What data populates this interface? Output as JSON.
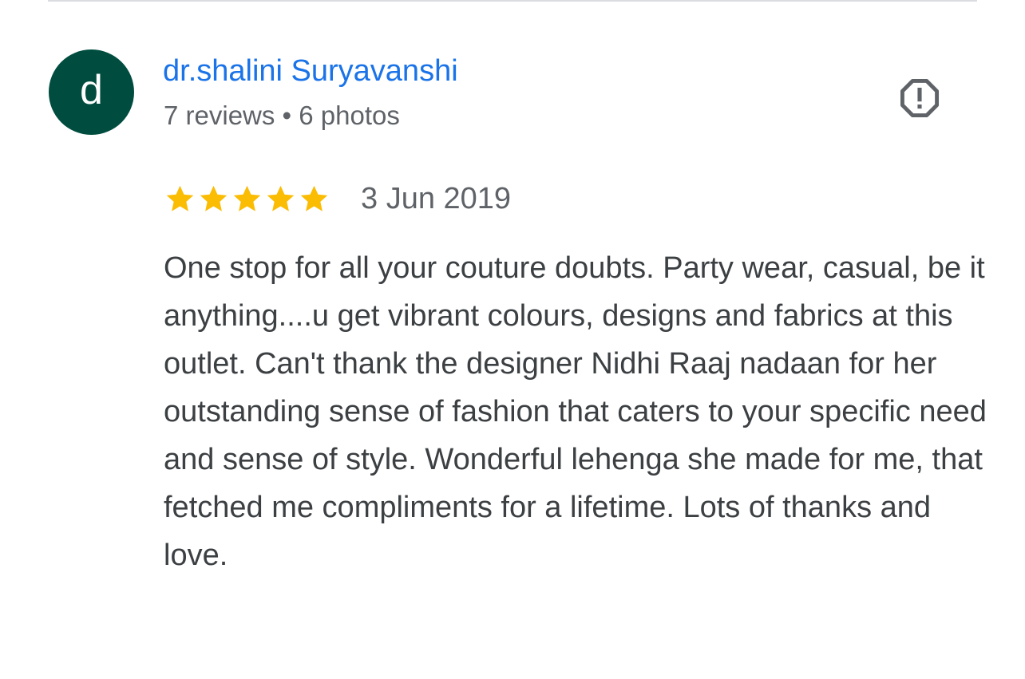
{
  "reviewer": {
    "avatar_letter": "d",
    "avatar_color": "#004d40",
    "name": "dr.shalini Suryavanshi",
    "meta": "7 reviews • 6 photos"
  },
  "report": {
    "icon": "report-flag-icon"
  },
  "review": {
    "rating": 5,
    "rating_max": 5,
    "star_color": "#fbbc04",
    "date": "3 Jun 2019",
    "text": "One stop for all your couture doubts. Party wear, casual, be it anything....u get vibrant colours, designs and fabrics at this outlet. Can't thank the designer Nidhi Raaj nadaan for her outstanding sense of fashion that caters to your specific need and sense of style. Wonderful lehenga she made for me, that fetched me compliments for a lifetime. Lots of thanks and love."
  }
}
